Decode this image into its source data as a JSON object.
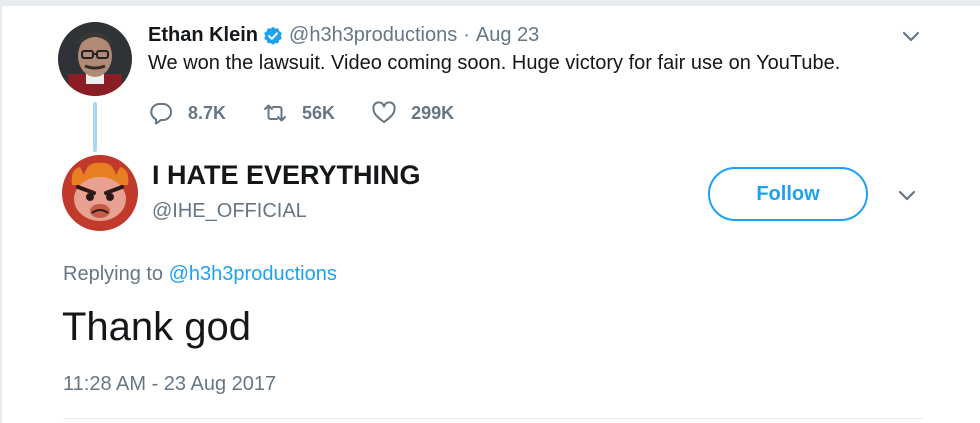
{
  "parent_tweet": {
    "display_name": "Ethan Klein",
    "handle": "@h3h3productions",
    "separator": "·",
    "date": "Aug 23",
    "text": "We won the lawsuit. Video coming soon. Huge victory for fair use on YouTube.",
    "actions": {
      "replies": "8.7K",
      "retweets": "56K",
      "likes": "299K"
    }
  },
  "main_tweet": {
    "display_name": "I HATE EVERYTHING",
    "handle": "@IHE_OFFICIAL",
    "follow_label": "Follow",
    "replying_prefix": "Replying to",
    "replying_handle": "@h3h3productions",
    "text": "Thank god",
    "timestamp": "11:28 AM - 23 Aug 2017"
  },
  "colors": {
    "accent": "#1da1f2",
    "secondary_text": "#657786",
    "primary_text": "#14171a",
    "verified": "#1da1f2",
    "thread_line": "#a7d8f6"
  },
  "icons": {
    "verified": "verified-badge-icon",
    "reply": "reply-icon",
    "retweet": "retweet-icon",
    "like": "heart-icon",
    "menu": "chevron-down-icon"
  }
}
